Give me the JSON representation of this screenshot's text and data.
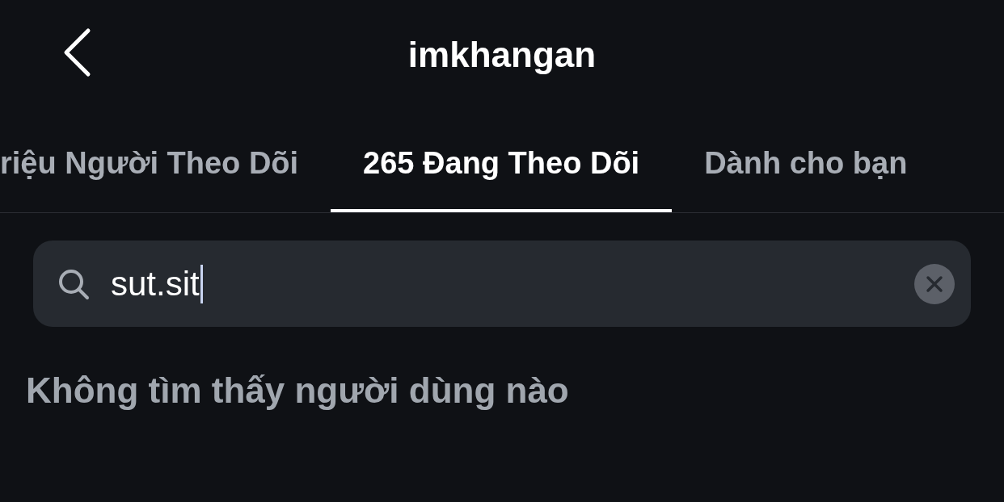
{
  "header": {
    "title": "imkhangan"
  },
  "tabs": [
    {
      "label": "riệu Người Theo Dõi",
      "selected": false
    },
    {
      "label": "265 Đang Theo Dõi",
      "selected": true
    },
    {
      "label": "Dành cho bạn",
      "selected": false
    }
  ],
  "search": {
    "value": "sut.sit",
    "focused": true
  },
  "empty_message": "Không tìm thấy người dùng nào"
}
